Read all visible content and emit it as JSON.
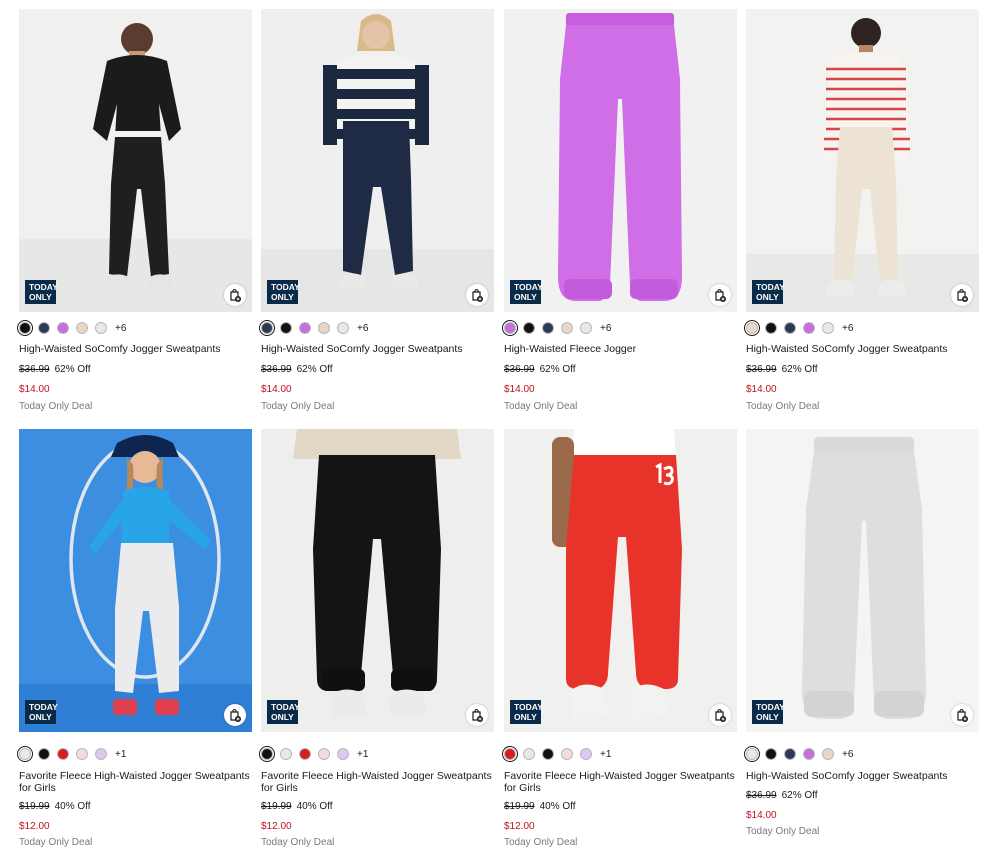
{
  "icons": {
    "bag": "shopping-bag-add-icon"
  },
  "colors": {
    "badge": "#0a2a4a",
    "sale": "#c0121f",
    "muted": "#7a7a7a"
  },
  "products": [
    {
      "badge_line1": "TODAY",
      "badge_line2": "ONLY",
      "swatches": [
        "#111111",
        "#2b3a55",
        "#c66ee0",
        "#e6d7c8",
        "#e8e8e8"
      ],
      "selected_swatch": 0,
      "more_colors": "+6",
      "title": "High-Waisted SoComfy Jogger Sweatpants",
      "original_price": "$36.99",
      "discount": "62% Off",
      "sale_price": "$14.00",
      "deal_label": "Today Only Deal"
    },
    {
      "badge_line1": "TODAY",
      "badge_line2": "ONLY",
      "swatches": [
        "#2b3a55",
        "#111111",
        "#c66ee0",
        "#e6d7c8",
        "#e8e8e8"
      ],
      "selected_swatch": 0,
      "more_colors": "+6",
      "title": "High-Waisted SoComfy Jogger Sweatpants",
      "original_price": "$36.99",
      "discount": "62% Off",
      "sale_price": "$14.00",
      "deal_label": "Today Only Deal"
    },
    {
      "badge_line1": "TODAY",
      "badge_line2": "ONLY",
      "swatches": [
        "#c66ee0",
        "#111111",
        "#2b3a55",
        "#e6d7c8",
        "#e8e8e8"
      ],
      "selected_swatch": 0,
      "more_colors": "+6",
      "title": "High-Waisted Fleece Jogger",
      "original_price": "$36.99",
      "discount": "62% Off",
      "sale_price": "$14.00",
      "deal_label": "Today Only Deal"
    },
    {
      "badge_line1": "TODAY",
      "badge_line2": "ONLY",
      "swatches": [
        "#e6d7c8",
        "#111111",
        "#2b3a55",
        "#c66ee0",
        "#e8e8e8"
      ],
      "selected_swatch": 0,
      "more_colors": "+6",
      "title": "High-Waisted SoComfy Jogger Sweatpants",
      "original_price": "$36.99",
      "discount": "62% Off",
      "sale_price": "$14.00",
      "deal_label": "Today Only Deal"
    },
    {
      "badge_line1": "TODAY",
      "badge_line2": "ONLY",
      "swatches": [
        "#e8e8e8",
        "#111111",
        "#d41e1e",
        "#f7dada",
        "#ddc8ee"
      ],
      "selected_swatch": 0,
      "more_colors": "+1",
      "title": "Favorite Fleece High-Waisted Jogger Sweatpants for Girls",
      "original_price": "$19.99",
      "discount": "40% Off",
      "sale_price": "$12.00",
      "deal_label": "Today Only Deal"
    },
    {
      "badge_line1": "TODAY",
      "badge_line2": "ONLY",
      "swatches": [
        "#111111",
        "#e8e8e8",
        "#d41e1e",
        "#f7dada",
        "#ddc8ee"
      ],
      "selected_swatch": 0,
      "more_colors": "+1",
      "title": "Favorite Fleece High-Waisted Jogger Sweatpants for Girls",
      "original_price": "$19.99",
      "discount": "40% Off",
      "sale_price": "$12.00",
      "deal_label": "Today Only Deal"
    },
    {
      "badge_line1": "TODAY",
      "badge_line2": "ONLY",
      "swatches": [
        "#d41e1e",
        "#e8e8e8",
        "#111111",
        "#f7dada",
        "#ddc8ee"
      ],
      "selected_swatch": 0,
      "more_colors": "+1",
      "title": "Favorite Fleece High-Waisted Jogger Sweatpants for Girls",
      "original_price": "$19.99",
      "discount": "40% Off",
      "sale_price": "$12.00",
      "deal_label": "Today Only Deal"
    },
    {
      "badge_line1": "TODAY",
      "badge_line2": "ONLY",
      "swatches": [
        "#e8e8e8",
        "#111111",
        "#2b3a55",
        "#c66ee0",
        "#e6d7c8"
      ],
      "selected_swatch": 0,
      "more_colors": "+6",
      "title": "High-Waisted SoComfy Jogger Sweatpants",
      "original_price": "$36.99",
      "discount": "62% Off",
      "sale_price": "$14.00",
      "deal_label": "Today Only Deal"
    }
  ]
}
